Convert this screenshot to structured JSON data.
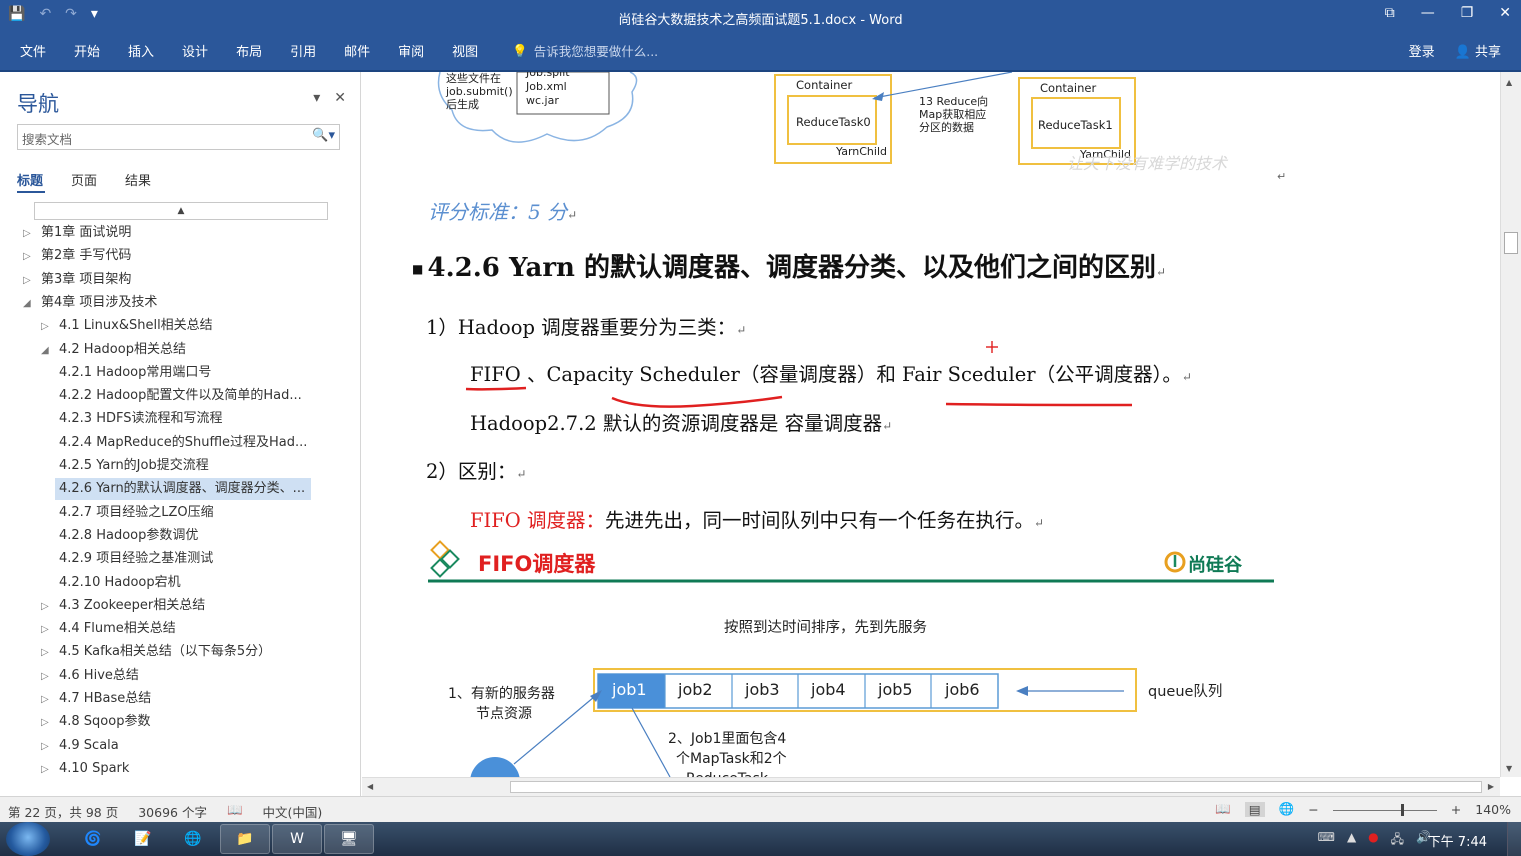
{
  "window": {
    "title": "尚硅谷大数据技术之高频面试题5.1.docx - Word",
    "qat": {
      "save": "💾",
      "undo": "↶",
      "redo": "↷",
      "more": "▾"
    },
    "controls": {
      "restore_ribbon": "⧉",
      "minimize": "—",
      "maximize": "❐",
      "close": "✕"
    }
  },
  "ribbon": {
    "tabs": [
      "文件",
      "开始",
      "插入",
      "设计",
      "布局",
      "引用",
      "邮件",
      "审阅",
      "视图"
    ],
    "tellme": "告诉我您想要做什么...",
    "login": "登录",
    "share": "共享"
  },
  "nav": {
    "title": "导航",
    "search_placeholder": "搜索文档",
    "tabs": [
      "标题",
      "页面",
      "结果"
    ],
    "items": [
      {
        "label": "第1章 面试说明",
        "level": 0,
        "arrow": "▷"
      },
      {
        "label": "第2章 手写代码",
        "level": 0,
        "arrow": "▷"
      },
      {
        "label": "第3章 项目架构",
        "level": 0,
        "arrow": "▷"
      },
      {
        "label": "第4章 项目涉及技术",
        "level": 0,
        "arrow": "◢"
      },
      {
        "label": "4.1 Linux&Shell相关总结",
        "level": 1,
        "arrow": "▷"
      },
      {
        "label": "4.2 Hadoop相关总结",
        "level": 1,
        "arrow": "◢"
      },
      {
        "label": "4.2.1 Hadoop常用端口号",
        "level": 2,
        "arrow": ""
      },
      {
        "label": "4.2.2 Hadoop配置文件以及简单的Had...",
        "level": 2,
        "arrow": ""
      },
      {
        "label": "4.2.3 HDFS读流程和写流程",
        "level": 2,
        "arrow": ""
      },
      {
        "label": "4.2.4 MapReduce的Shuffle过程及Had...",
        "level": 2,
        "arrow": ""
      },
      {
        "label": "4.2.5 Yarn的Job提交流程",
        "level": 2,
        "arrow": ""
      },
      {
        "label": "4.2.6 Yarn的默认调度器、调度器分类、...",
        "level": 2,
        "arrow": "",
        "selected": true
      },
      {
        "label": "4.2.7 项目经验之LZO压缩",
        "level": 2,
        "arrow": ""
      },
      {
        "label": "4.2.8 Hadoop参数调优",
        "level": 2,
        "arrow": ""
      },
      {
        "label": "4.2.9 项目经验之基准测试",
        "level": 2,
        "arrow": ""
      },
      {
        "label": "4.2.10 Hadoop宕机",
        "level": 2,
        "arrow": ""
      },
      {
        "label": "4.3 Zookeeper相关总结",
        "level": 1,
        "arrow": "▷"
      },
      {
        "label": "4.4 Flume相关总结",
        "level": 1,
        "arrow": "▷"
      },
      {
        "label": "4.5 Kafka相关总结（以下每条5分）",
        "level": 1,
        "arrow": "▷"
      },
      {
        "label": "4.6 Hive总结",
        "level": 1,
        "arrow": "▷"
      },
      {
        "label": "4.7 HBase总结",
        "level": 1,
        "arrow": "▷"
      },
      {
        "label": "4.8 Sqoop参数",
        "level": 1,
        "arrow": "▷"
      },
      {
        "label": "4.9 Scala",
        "level": 1,
        "arrow": "▷"
      },
      {
        "label": "4.10 Spark",
        "level": 1,
        "arrow": "▷"
      }
    ]
  },
  "doc": {
    "top_fig": {
      "cloud_text": [
        "这些文件在",
        "job.submit()",
        "后生成"
      ],
      "files_text": [
        "Job.split",
        "Job.xml",
        "wc.jar"
      ],
      "container1": "Container",
      "task0": "ReduceTask0",
      "yarnchild1": "YarnChild",
      "step13": [
        "13 Reduce向",
        "Map获取相应",
        "分区的数据"
      ],
      "container2": "Container",
      "task1": "ReduceTask1",
      "yarnchild2": "YarnChild",
      "watermark": "让天下没有难学的技术"
    },
    "score": "评分标准：5 分",
    "heading": "4.2.6 Yarn 的默认调度器、调度器分类、以及他们之间的区别",
    "p1": "1）Hadoop 调度器重要分为三类：",
    "p2": "FIFO 、Capacity Scheduler（容量调度器）和 Fair Sceduler（公平调度器）。",
    "p3": "Hadoop2.7.2 默认的资源调度器是 容量调度器",
    "p4": "2）区别：",
    "p5_red": "FIFO 调度器：",
    "p5_rest": "先进先出，同一时间队列中只有一个任务在执行。",
    "para_mark": "↵",
    "fifo_fig": {
      "title": "FIFO调度器",
      "brand": "尚硅谷",
      "subtitle": "按照到达时间排序，先到先服务",
      "jobs": [
        "job1",
        "job2",
        "job3",
        "job4",
        "job5",
        "job6"
      ],
      "queue": "queue队列",
      "step1": [
        "1、有新的服务器",
        "节点资源"
      ],
      "step2": [
        "2、Job1里面包含4",
        "个MapTask和2个",
        "ReduceTask"
      ]
    }
  },
  "status": {
    "page": "第 22 页，共 98 页",
    "words": "30696 个字",
    "lang": "中文(中国)",
    "zoom": "140%"
  },
  "taskbar": {
    "clock": "下午 7:44"
  },
  "colors": {
    "word_blue": "#2b579a",
    "red_text": "#e02020",
    "fig_green": "#0f8a5f",
    "box_yellow": "#f5c842",
    "job_blue": "#4a90d9"
  }
}
